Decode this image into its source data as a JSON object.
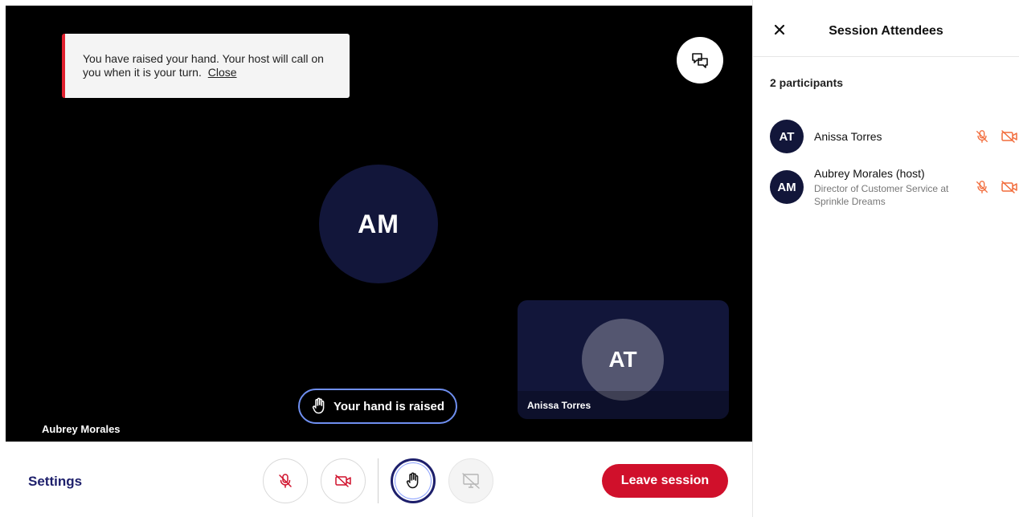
{
  "video": {
    "toast": {
      "message": "You have raised your hand. Your host will call on you when it is your turn.",
      "close_label": "Close"
    },
    "main_speaker": {
      "initials": "AM",
      "name": "Aubrey Morales"
    },
    "hand_indicator": {
      "label": "Your hand is raised"
    },
    "self_tile": {
      "initials": "AT",
      "name": "Anissa Torres"
    }
  },
  "controls": {
    "settings_label": "Settings",
    "leave_label": "Leave session"
  },
  "panel": {
    "title": "Session Attendees",
    "participant_count": "2 participants",
    "attendees": [
      {
        "initials": "AT",
        "name": "Anissa Torres",
        "title": ""
      },
      {
        "initials": "AM",
        "name": "Aubrey Morales (host)",
        "title": "Director of Customer Service at Sprinkle Dreams"
      }
    ]
  },
  "colors": {
    "brand_navy": "#12163a",
    "danger_red": "#d0102b",
    "muted_orange": "#f26b3a",
    "highlight_blue": "#6f8ff0"
  },
  "icons": [
    "chat-icon",
    "hand-icon",
    "mic-off-icon",
    "camera-off-icon",
    "screen-share-off-icon",
    "close-icon"
  ]
}
